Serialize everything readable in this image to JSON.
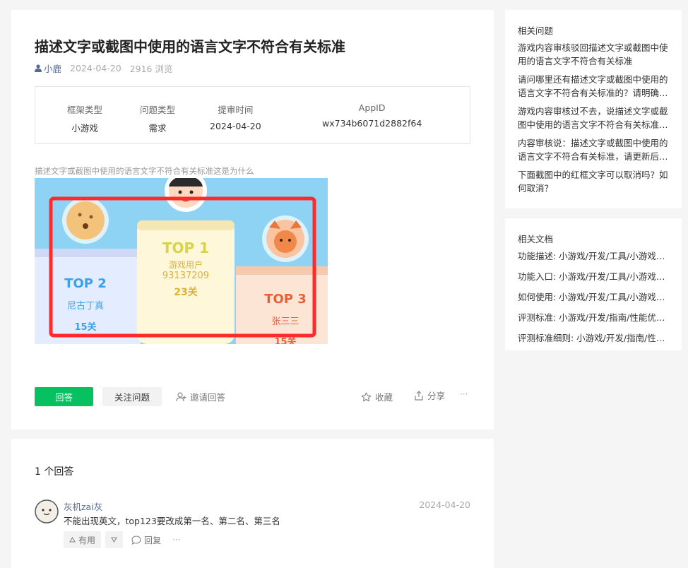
{
  "question": {
    "title": "描述文字或截图中使用的语言文字不符合有关标准",
    "author": "小鹿",
    "date": "2024-04-20",
    "views": "2916 浏览",
    "info": [
      {
        "header": "框架类型",
        "value": "小游戏"
      },
      {
        "header": "问题类型",
        "value": "需求"
      },
      {
        "header": "提审时间",
        "value": "2024-04-20"
      },
      {
        "header": "AppID",
        "value": "wx734b6071d2882f64"
      }
    ],
    "image_caption": "描述文字或截图中使用的语言文字不符合有关标准这是为什么",
    "screenshot": {
      "top2_label": "TOP 2",
      "top2_name": "尼古丁真",
      "top2_level": "15关",
      "top1_label": "TOP 1",
      "top1_name": "游戏用户",
      "top1_score": "93137209",
      "top1_level": "23关",
      "top3_label": "TOP 3",
      "top3_name": "张三三",
      "top3_level": "15关"
    },
    "actions": {
      "answer": "回答",
      "follow": "关注问题",
      "invite": "邀请回答",
      "favorite": "收藏",
      "share": "分享",
      "more": "···"
    }
  },
  "answers": {
    "count_label": "1 个回答",
    "items": [
      {
        "author": "灰机zai灰",
        "date": "2024-04-20",
        "content": "不能出现英文，top123要改成第一名、第二名、第三名",
        "useful": "有用",
        "reply": "回复",
        "more": "···"
      }
    ]
  },
  "sidebar": {
    "related_questions_title": "相关问题",
    "related_questions": [
      "游戏内容审核驳回描述文字或截图中使用的语言文字不符合有关标准",
      "请问哪里还有描述文字或截图中使用的语言文字不符合有关标准的？请明确支出...",
      "游戏内容审核过不去，说描述文字或截图中使用的语言文字不符合有关标准，该...",
      "内容审核说：描述文字或截图中使用的语言文字不符合有关标准，请更新后重新...",
      "下面截图中的红框文字可以取消吗？如何取消？"
    ],
    "related_docs_title": "相关文档",
    "related_docs": [
      "功能描述: 小游戏/开发/工具/小游戏调...",
      "功能入口: 小游戏/开发/工具/小游戏调...",
      "如何使用: 小游戏/开发/工具/小游戏调...",
      "评测标准: 小游戏/开发/指南/性能优化/...",
      "评测标准细则: 小游戏/开发/指南/性能..."
    ]
  },
  "colors": {
    "accent_green": "#07c160",
    "link_blue": "#576b95",
    "highlight_red": "#ff2a2a",
    "sky_blue": "#8fd3f4"
  }
}
